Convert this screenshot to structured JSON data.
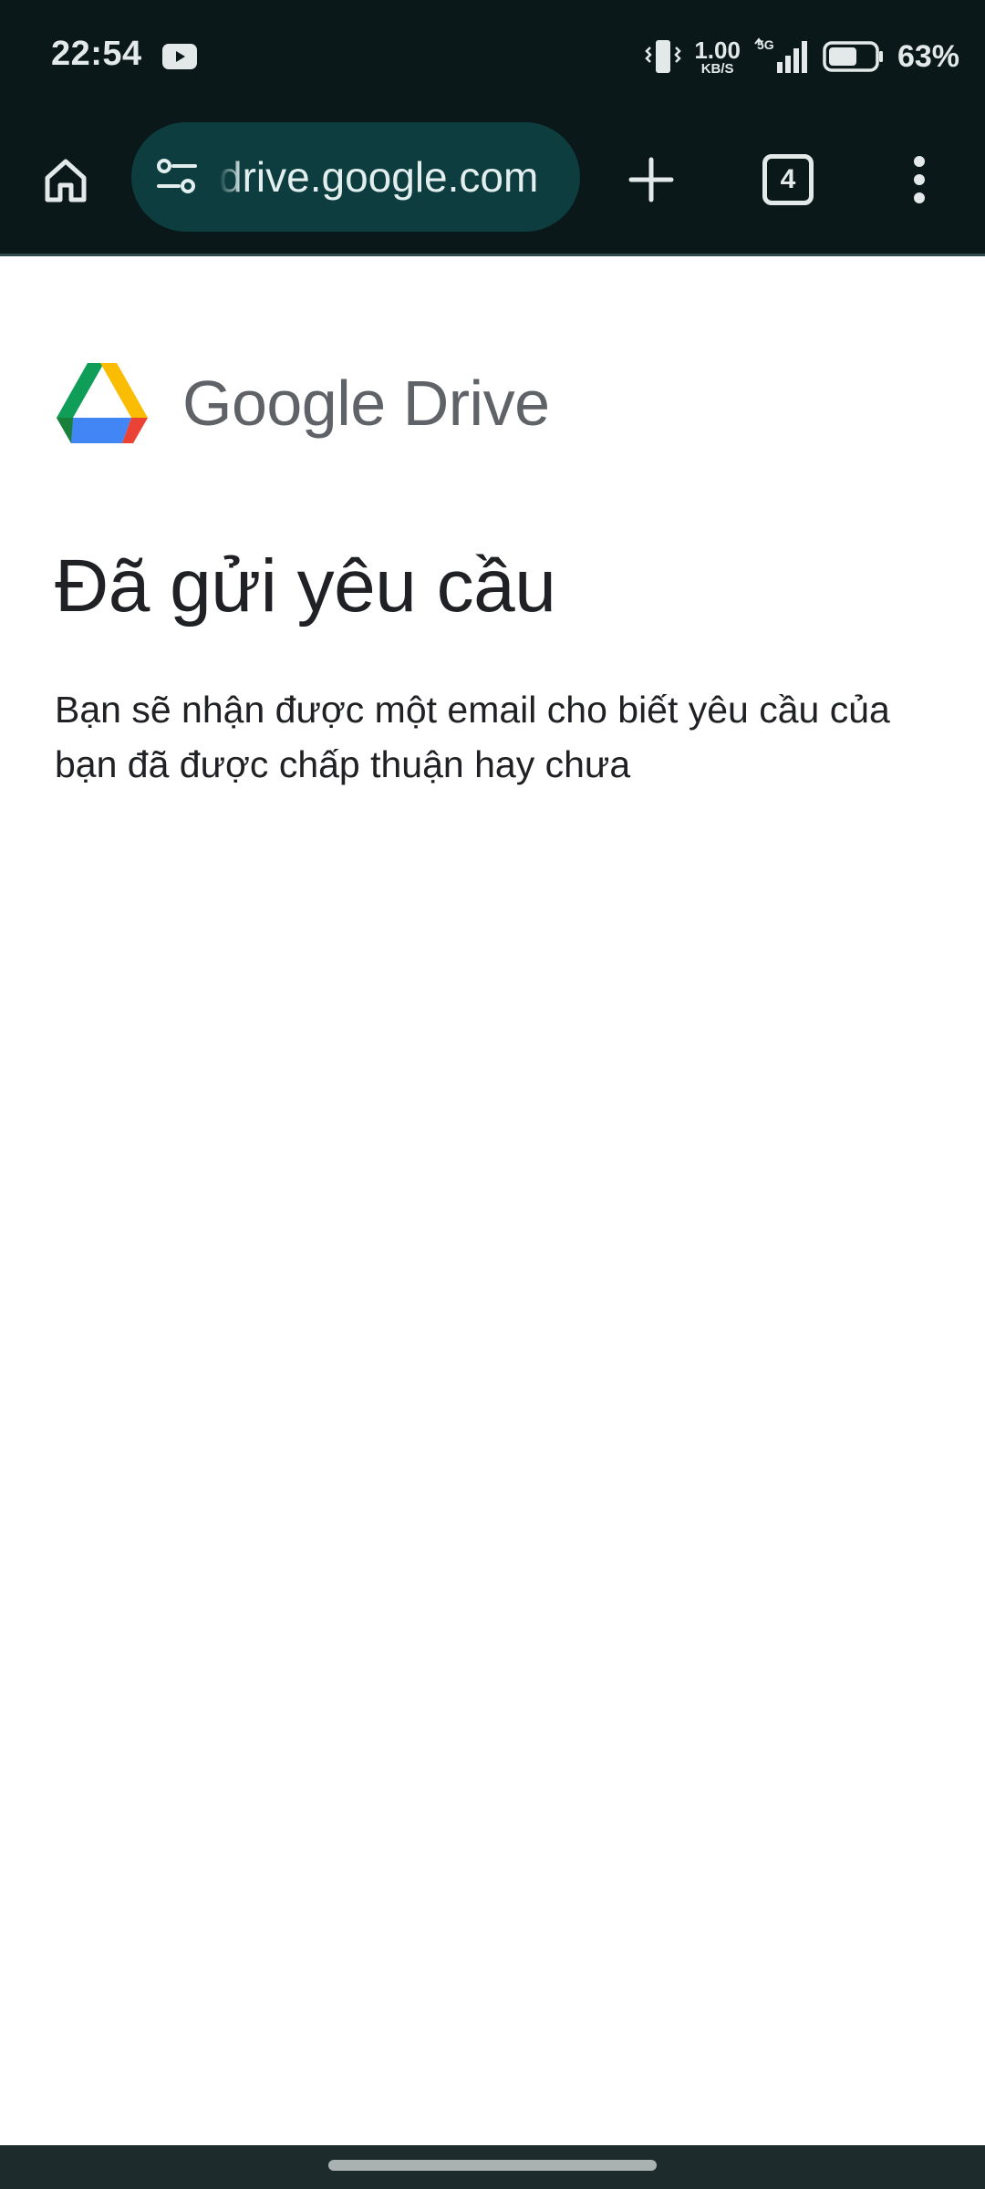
{
  "status_bar": {
    "time": "22:54",
    "net_speed_value": "1.00",
    "net_speed_unit": "KB/S",
    "network_type": "5G",
    "battery_percent": "63%",
    "battery_level": 0.63
  },
  "browser": {
    "url": "drive.google.com",
    "tab_count": "4"
  },
  "page": {
    "brand_google": "Google",
    "brand_product": "Drive",
    "heading": "Đã gửi yêu cầu",
    "description": "Bạn sẽ nhận được một email cho biết yêu cầu của bạn đã được chấp thuận hay chưa"
  },
  "colors": {
    "chrome_background": "#0a1819",
    "omnibox_background": "#0d3d3f",
    "drive_green": "#0f9d58",
    "drive_yellow": "#fbbc04",
    "drive_blue": "#4285f4",
    "drive_red": "#ea4335"
  },
  "icons": {
    "status": [
      "youtube-icon",
      "vibrate-icon",
      "signal-icon",
      "battery-icon"
    ],
    "toolbar": [
      "home-icon",
      "site-settings-icon",
      "plus-icon",
      "tab-switcher-icon",
      "more-vert-icon"
    ],
    "page": [
      "google-drive-logo"
    ]
  }
}
